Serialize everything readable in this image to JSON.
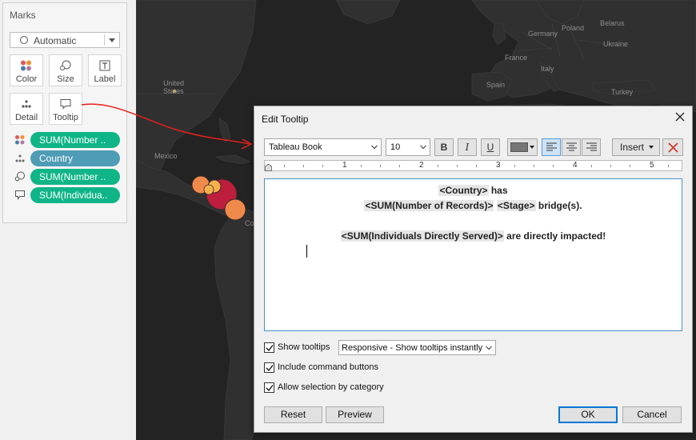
{
  "marks": {
    "title": "Marks",
    "mark_type": "Automatic",
    "buttons": [
      {
        "label": "Color",
        "icon": "color-dots-icon"
      },
      {
        "label": "Size",
        "icon": "size-icon"
      },
      {
        "label": "Label",
        "icon": "label-icon"
      },
      {
        "label": "Detail",
        "icon": "detail-dots-icon"
      },
      {
        "label": "Tooltip",
        "icon": "tooltip-icon"
      }
    ],
    "pills": [
      {
        "label": "SUM(Number ..",
        "icon": "color-dots-icon",
        "color": "#10b587"
      },
      {
        "label": "Country",
        "icon": "detail-dots-icon",
        "color": "#4f9cb6"
      },
      {
        "label": "SUM(Number ..",
        "icon": "size-icon",
        "color": "#10b587"
      },
      {
        "label": "SUM(Individua..",
        "icon": "tooltip-icon",
        "color": "#10b587"
      }
    ]
  },
  "map": {
    "labels": [
      "Poland",
      "Germany",
      "Belarus",
      "Ukraine",
      "France",
      "Italy",
      "Spain",
      "Turkey",
      "United States",
      "Mexico",
      "Co"
    ]
  },
  "dialog": {
    "title": "Edit Tooltip",
    "font": "Tableau Book",
    "size": "10",
    "bold_label": "B",
    "italic_label": "I",
    "underline_label": "U",
    "text_color": "#767676",
    "insert_label": "Insert",
    "ruler_numbers": [
      "1",
      "2",
      "3",
      "4",
      "5"
    ],
    "editor": {
      "line1_token": "<Country>",
      "line1_text": " has",
      "line2_token1": "<SUM(Number of Records)>",
      "line2_token2": "<Stage>",
      "line2_text": " bridge(s).",
      "line3_token": "<SUM(Individuals Directly Served)>",
      "line3_text": " are directly impacted!"
    },
    "show_tooltips": {
      "label": "Show tooltips",
      "checked": true
    },
    "tooltip_mode": "Responsive - Show tooltips instantly",
    "include_command_buttons": {
      "label": "Include command buttons",
      "checked": true
    },
    "allow_selection": {
      "label": "Allow selection by category",
      "checked": true
    },
    "reset_label": "Reset",
    "preview_label": "Preview",
    "ok_label": "OK",
    "cancel_label": "Cancel"
  },
  "colors": {
    "pill_green": "#10b587",
    "pill_blue": "#4f9cb6",
    "map_bg": "#232323",
    "accent": "#0078d7",
    "annotation_red": "#e8201a"
  }
}
